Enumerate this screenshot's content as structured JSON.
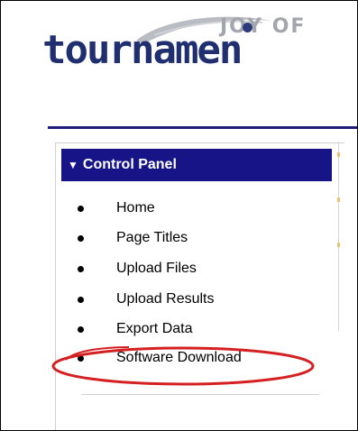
{
  "logo": {
    "top_text": "JOY OF",
    "main_text": "tournamen"
  },
  "panel": {
    "title": "Control Panel",
    "toggle_icon": "triangle-down-icon",
    "items": [
      {
        "label": "Home"
      },
      {
        "label": "Page Titles"
      },
      {
        "label": "Upload Files"
      },
      {
        "label": "Upload Results"
      },
      {
        "label": "Export Data"
      },
      {
        "label": "Software Download",
        "highlighted": true
      }
    ]
  },
  "colors": {
    "header_bg": "#161487",
    "logo_main": "#1f2f6f",
    "logo_top": "#a3a6ad",
    "highlight": "#d42020"
  }
}
